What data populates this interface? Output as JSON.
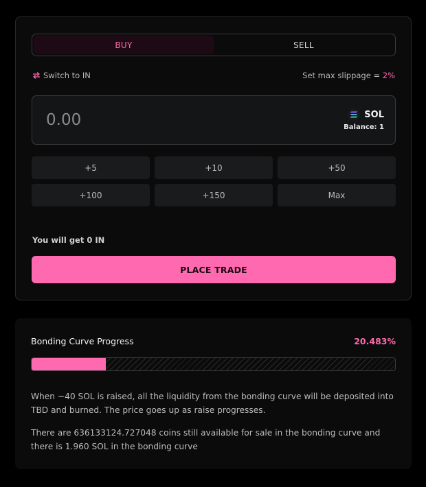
{
  "trade": {
    "tabs": {
      "buy": "BUY",
      "sell": "SELL",
      "active": "buy"
    },
    "switch_label": "Switch to IN",
    "slippage_label": "Set max slippage = ",
    "slippage_value": "2%",
    "amount": {
      "value": "",
      "placeholder": "0.00"
    },
    "token": {
      "symbol": "SOL",
      "icon": "solana-icon",
      "balance_label": "Balance: 1"
    },
    "presets": [
      "+5",
      "+10",
      "+50",
      "+100",
      "+150",
      "Max"
    ],
    "you_get": "You will get 0 IN",
    "place_trade": "PLACE TRADE"
  },
  "curve": {
    "title": "Bonding Curve Progress",
    "percent_label": "20.483%",
    "progress": 0.20483,
    "text1": "When ~40 SOL is raised, all the liquidity from the bonding curve will be deposited into TBD and burned. The price goes up as raise progresses.",
    "text2": "There are 636133124.727048 coins still available for sale in the bonding curve and there is 1.960 SOL in the bonding curve"
  },
  "colors": {
    "accent": "#ff69af",
    "background": "#000000",
    "card": "#0b0b0c",
    "border": "#3a3a3c"
  }
}
